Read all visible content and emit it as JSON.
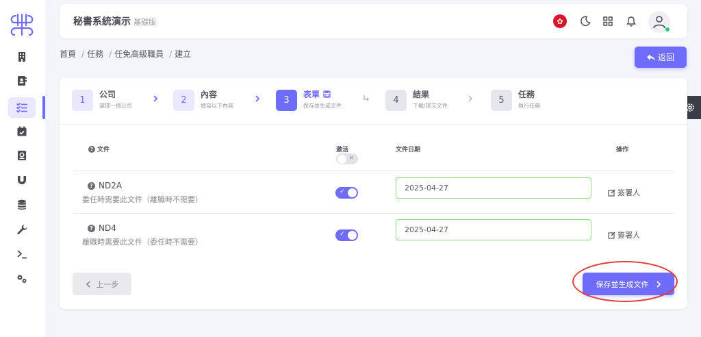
{
  "header": {
    "title": "秘書系統演示",
    "edition": "基礎版"
  },
  "sidebar": {
    "items": [
      {
        "icon": "building-icon"
      },
      {
        "icon": "contacts-icon"
      },
      {
        "icon": "task-list-icon",
        "active": true
      },
      {
        "icon": "calendar-check-icon"
      },
      {
        "icon": "address-book-icon"
      },
      {
        "icon": "magnet-icon"
      },
      {
        "icon": "database-icon"
      },
      {
        "icon": "wrench-icon"
      },
      {
        "icon": "terminal-icon"
      },
      {
        "icon": "gears-icon"
      }
    ]
  },
  "breadcrumb": {
    "items": [
      "首頁",
      "任務",
      "任免高級職員",
      "建立"
    ]
  },
  "back_button": {
    "label": "返回"
  },
  "stepper": {
    "steps": [
      {
        "number": "1",
        "title": "公司",
        "subtitle": "選擇一個公司",
        "state": "done"
      },
      {
        "number": "2",
        "title": "內容",
        "subtitle": "填寫以下內容",
        "state": "done"
      },
      {
        "number": "3",
        "title": "表單",
        "subtitle": "保存並生成文件",
        "state": "active"
      },
      {
        "number": "4",
        "title": "結果",
        "subtitle": "下載/提交文件",
        "state": "pending"
      },
      {
        "number": "5",
        "title": "任務",
        "subtitle": "執行任務",
        "state": "pending"
      }
    ]
  },
  "table": {
    "columns": {
      "document": "文件",
      "active": "激活",
      "date": "文件日期",
      "action": "操作"
    },
    "rows": [
      {
        "name": "ND2A",
        "description": "委任時需要此文件（離職時不需要）",
        "active": true,
        "date": "2025-04-27",
        "action": "簽署人"
      },
      {
        "name": "ND4",
        "description": "離職時需要此文件（委任時不需要）",
        "active": true,
        "date": "2025-04-27",
        "action": "簽署人"
      }
    ]
  },
  "footer": {
    "prev_label": "上一步",
    "save_label": "保存並生成文件"
  },
  "colors": {
    "accent": "#6f6bfb",
    "annotation": "#e03a3a",
    "valid_border": "#8fdc7d"
  }
}
